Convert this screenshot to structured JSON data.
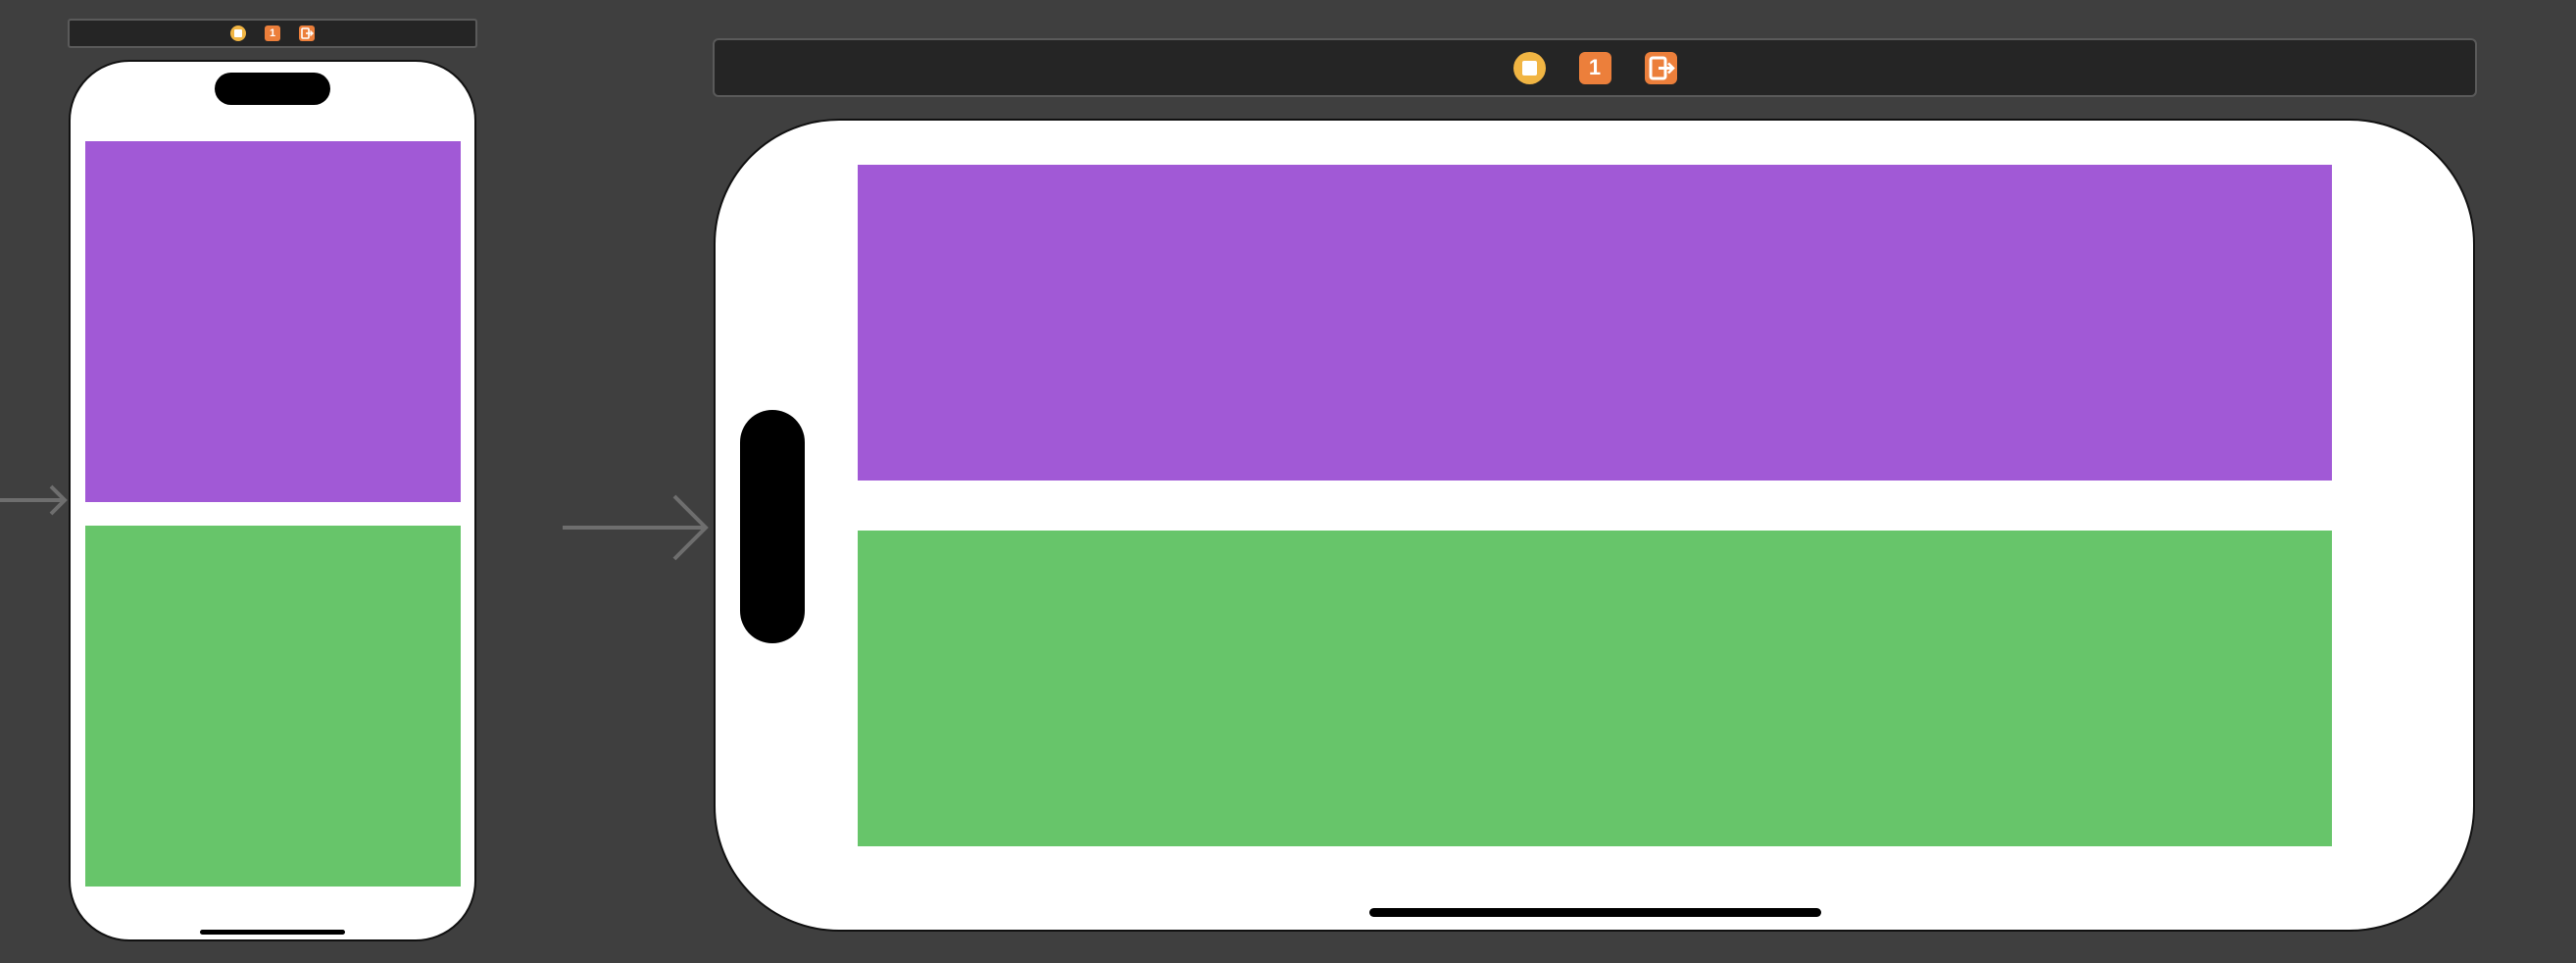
{
  "storyboard": {
    "scenes": [
      {
        "orientation": "portrait",
        "header": {
          "view_controller_icon": "view-controller-icon",
          "first_responder_icon": "first-responder-icon",
          "first_responder_glyph": "1",
          "exit_icon": "exit-icon"
        },
        "views": [
          {
            "color": "#a159d6",
            "name": "purple-view"
          },
          {
            "color": "#67c56a",
            "name": "green-view"
          }
        ]
      },
      {
        "orientation": "landscape",
        "header": {
          "view_controller_icon": "view-controller-icon",
          "first_responder_icon": "first-responder-icon",
          "first_responder_glyph": "1",
          "exit_icon": "exit-icon"
        },
        "views": [
          {
            "color": "#a159d6",
            "name": "purple-view"
          },
          {
            "color": "#67c56a",
            "name": "green-view"
          }
        ]
      }
    ],
    "colors": {
      "canvas": "#3f3f3f",
      "scene_bar": "#252525",
      "view_controller_icon": "#f1b543",
      "first_responder_icon": "#ec7f3b",
      "exit_icon": "#ec7f3b",
      "device_background": "#ffffff"
    }
  }
}
